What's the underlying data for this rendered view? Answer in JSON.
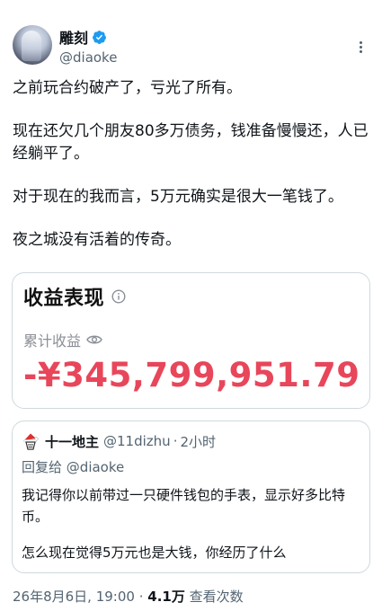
{
  "author": {
    "display_name": "雕刻",
    "handle": "@diaoke",
    "avatar_icon": "anime-avatar-icon",
    "verified_icon": "verified-badge-icon",
    "more_icon": "more-options-icon"
  },
  "tweet": {
    "paragraphs": [
      "之前玩合约破产了，亏光了所有。",
      "现在还欠几个朋友80多万债务，钱准备慢慢还，人已经躺平了。",
      "对于现在的我而言，5万元确实是很大一笔钱了。",
      "夜之城没有活着的传奇。"
    ]
  },
  "profit_card": {
    "title": "收益表现",
    "label": "累计收益",
    "value": "-¥345,799,951.79",
    "value_color": "#e8465a",
    "info_icon": "info-icon",
    "eye_icon": "eye-icon"
  },
  "reply": {
    "name": "十一地主",
    "handle": "@11dizhu",
    "separator": "·",
    "time": "2小时",
    "reply_to_prefix": "回复给",
    "reply_to_handle": "@diaoke",
    "paragraphs": [
      "我记得你以前带过一只硬件钱包的手表，显示好多比特币。",
      "怎么现在觉得5万元也是大钱，你经历了什么"
    ],
    "avatar_icon": "santa-avatar-icon"
  },
  "meta": {
    "timestamp": "26年8月6日, 19:00",
    "separator": "·",
    "views_count": "4.1万",
    "views_label": "查看次数"
  },
  "colors": {
    "text": "#0f1419",
    "secondary": "#536471",
    "verified": "#1d9bf0",
    "loss": "#e8465a",
    "border": "#cfd9de"
  }
}
